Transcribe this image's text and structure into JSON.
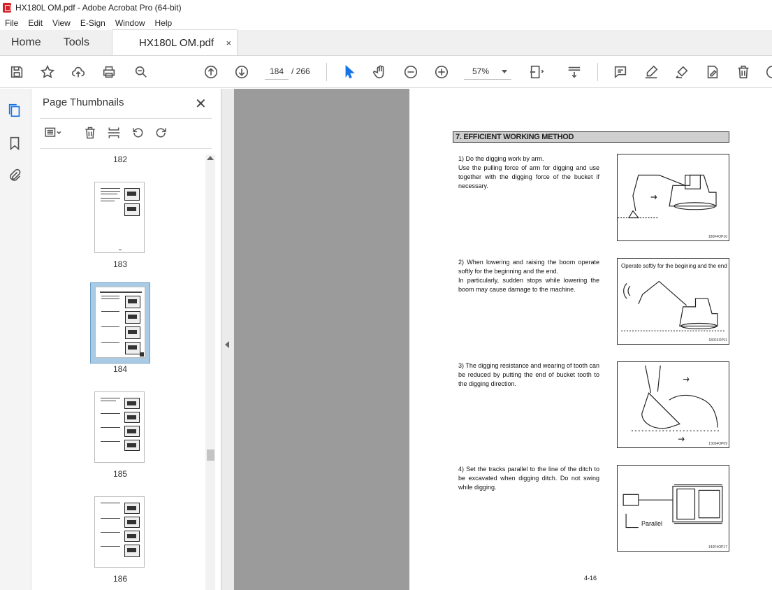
{
  "window": {
    "title": "HX180L OM.pdf - Adobe Acrobat Pro (64-bit)"
  },
  "menu": [
    "File",
    "Edit",
    "View",
    "E-Sign",
    "Window",
    "Help"
  ],
  "tabs": {
    "home": "Home",
    "tools": "Tools",
    "document": "HX180L OM.pdf",
    "close": "×"
  },
  "toolbar": {
    "current_page": "184",
    "page_total": "/ 266",
    "zoom": "57%"
  },
  "panel": {
    "title": "Page Thumbnails",
    "close": "✕",
    "thumbnails": [
      {
        "label": "182"
      },
      {
        "label": "183"
      },
      {
        "label": "184",
        "selected": true
      },
      {
        "label": "185"
      },
      {
        "label": "186"
      }
    ]
  },
  "document": {
    "section_title": "7. EFFICIENT WORKING METHOD",
    "items": [
      {
        "text": "1) Do the digging work by arm.\nUse the pulling force of arm for digging and use together with the digging force of the bucket if necessary.",
        "figure_code": "180F4OP10"
      },
      {
        "text": "2) When lowering and raising the boom operate softly for the beginning and the end.\nIn particularly, sudden stops while lowering the boom may cause damage to the machine.",
        "figure_code": "180F4OP11",
        "figure_caption": "Operate softly for the begining and the end"
      },
      {
        "text": "3) The digging resistance and wearing of tooth can be reduced by putting the end of bucket tooth to the digging direction.",
        "figure_code": "13034OP09"
      },
      {
        "text": "4) Set the tracks parallel to the line of the ditch to be excavated when digging ditch.  Do not swing while digging.",
        "figure_code": "140F4OP17",
        "figure_caption": "Parallel"
      }
    ],
    "page_number": "4-16"
  },
  "colors": {
    "accent": "#1473e6",
    "acrobat_red": "#d3222a",
    "selected_thumb": "#a9cbe6"
  }
}
